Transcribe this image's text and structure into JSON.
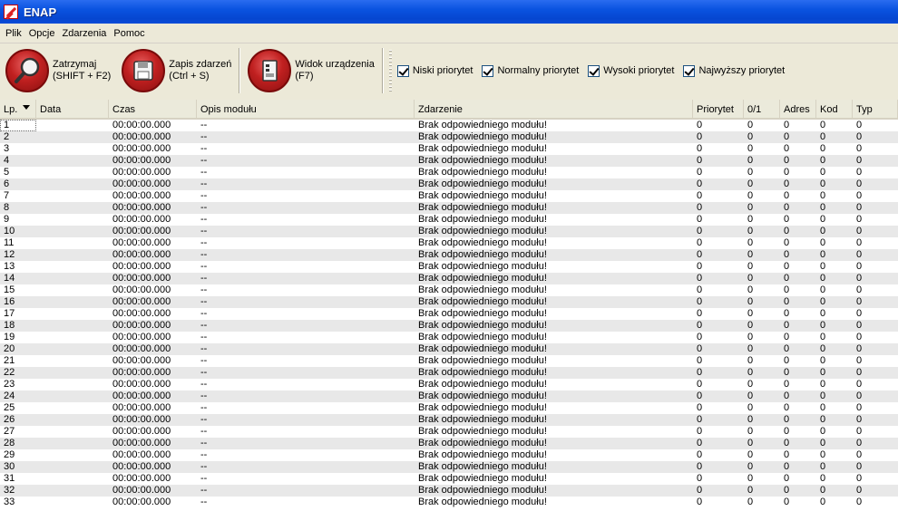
{
  "window": {
    "title": "ENAP"
  },
  "menu": [
    "Plik",
    "Opcje",
    "Zdarzenia",
    "Pomoc"
  ],
  "toolbar": {
    "stop": {
      "line1": "Zatrzymaj",
      "line2": "(SHIFT + F2)",
      "icon": "magnifier-icon"
    },
    "save": {
      "line1": "Zapis zdarzeń",
      "line2": "(Ctrl + S)",
      "icon": "floppy-disk-icon"
    },
    "device": {
      "line1": "Widok urządzenia",
      "line2": "(F7)",
      "icon": "device-icon"
    },
    "filters": [
      {
        "label": "Niski priorytet",
        "checked": true
      },
      {
        "label": "Normalny priorytet",
        "checked": true
      },
      {
        "label": "Wysoki priorytet",
        "checked": true
      },
      {
        "label": "Najwyższy priorytet",
        "checked": true
      }
    ]
  },
  "table": {
    "columns": [
      "Lp.",
      "Data",
      "Czas",
      "Opis modułu",
      "Zdarzenie",
      "Priorytet",
      "0/1",
      "Adres",
      "Kod",
      "Typ"
    ],
    "sort_column": "Lp.",
    "row_template": {
      "data": "",
      "czas": "00:00:00.000",
      "opis": "--",
      "zdarzenie": "Brak odpowiedniego modułu!",
      "priorytet": "0",
      "v01": "0",
      "adres": "0",
      "kod": "0",
      "typ": "0"
    },
    "rows": [
      [
        "1",
        "",
        "00:00:00.000",
        "--",
        "Brak odpowiedniego modułu!",
        "0",
        "0",
        "0",
        "0",
        "0"
      ],
      [
        "2",
        "",
        "00:00:00.000",
        "--",
        "Brak odpowiedniego modułu!",
        "0",
        "0",
        "0",
        "0",
        "0"
      ],
      [
        "3",
        "",
        "00:00:00.000",
        "--",
        "Brak odpowiedniego modułu!",
        "0",
        "0",
        "0",
        "0",
        "0"
      ],
      [
        "4",
        "",
        "00:00:00.000",
        "--",
        "Brak odpowiedniego modułu!",
        "0",
        "0",
        "0",
        "0",
        "0"
      ],
      [
        "5",
        "",
        "00:00:00.000",
        "--",
        "Brak odpowiedniego modułu!",
        "0",
        "0",
        "0",
        "0",
        "0"
      ],
      [
        "6",
        "",
        "00:00:00.000",
        "--",
        "Brak odpowiedniego modułu!",
        "0",
        "0",
        "0",
        "0",
        "0"
      ],
      [
        "7",
        "",
        "00:00:00.000",
        "--",
        "Brak odpowiedniego modułu!",
        "0",
        "0",
        "0",
        "0",
        "0"
      ],
      [
        "8",
        "",
        "00:00:00.000",
        "--",
        "Brak odpowiedniego modułu!",
        "0",
        "0",
        "0",
        "0",
        "0"
      ],
      [
        "9",
        "",
        "00:00:00.000",
        "--",
        "Brak odpowiedniego modułu!",
        "0",
        "0",
        "0",
        "0",
        "0"
      ],
      [
        "10",
        "",
        "00:00:00.000",
        "--",
        "Brak odpowiedniego modułu!",
        "0",
        "0",
        "0",
        "0",
        "0"
      ],
      [
        "11",
        "",
        "00:00:00.000",
        "--",
        "Brak odpowiedniego modułu!",
        "0",
        "0",
        "0",
        "0",
        "0"
      ],
      [
        "12",
        "",
        "00:00:00.000",
        "--",
        "Brak odpowiedniego modułu!",
        "0",
        "0",
        "0",
        "0",
        "0"
      ],
      [
        "13",
        "",
        "00:00:00.000",
        "--",
        "Brak odpowiedniego modułu!",
        "0",
        "0",
        "0",
        "0",
        "0"
      ],
      [
        "14",
        "",
        "00:00:00.000",
        "--",
        "Brak odpowiedniego modułu!",
        "0",
        "0",
        "0",
        "0",
        "0"
      ],
      [
        "15",
        "",
        "00:00:00.000",
        "--",
        "Brak odpowiedniego modułu!",
        "0",
        "0",
        "0",
        "0",
        "0"
      ],
      [
        "16",
        "",
        "00:00:00.000",
        "--",
        "Brak odpowiedniego modułu!",
        "0",
        "0",
        "0",
        "0",
        "0"
      ],
      [
        "17",
        "",
        "00:00:00.000",
        "--",
        "Brak odpowiedniego modułu!",
        "0",
        "0",
        "0",
        "0",
        "0"
      ],
      [
        "18",
        "",
        "00:00:00.000",
        "--",
        "Brak odpowiedniego modułu!",
        "0",
        "0",
        "0",
        "0",
        "0"
      ],
      [
        "19",
        "",
        "00:00:00.000",
        "--",
        "Brak odpowiedniego modułu!",
        "0",
        "0",
        "0",
        "0",
        "0"
      ],
      [
        "20",
        "",
        "00:00:00.000",
        "--",
        "Brak odpowiedniego modułu!",
        "0",
        "0",
        "0",
        "0",
        "0"
      ],
      [
        "21",
        "",
        "00:00:00.000",
        "--",
        "Brak odpowiedniego modułu!",
        "0",
        "0",
        "0",
        "0",
        "0"
      ],
      [
        "22",
        "",
        "00:00:00.000",
        "--",
        "Brak odpowiedniego modułu!",
        "0",
        "0",
        "0",
        "0",
        "0"
      ],
      [
        "23",
        "",
        "00:00:00.000",
        "--",
        "Brak odpowiedniego modułu!",
        "0",
        "0",
        "0",
        "0",
        "0"
      ],
      [
        "24",
        "",
        "00:00:00.000",
        "--",
        "Brak odpowiedniego modułu!",
        "0",
        "0",
        "0",
        "0",
        "0"
      ],
      [
        "25",
        "",
        "00:00:00.000",
        "--",
        "Brak odpowiedniego modułu!",
        "0",
        "0",
        "0",
        "0",
        "0"
      ],
      [
        "26",
        "",
        "00:00:00.000",
        "--",
        "Brak odpowiedniego modułu!",
        "0",
        "0",
        "0",
        "0",
        "0"
      ],
      [
        "27",
        "",
        "00:00:00.000",
        "--",
        "Brak odpowiedniego modułu!",
        "0",
        "0",
        "0",
        "0",
        "0"
      ],
      [
        "28",
        "",
        "00:00:00.000",
        "--",
        "Brak odpowiedniego modułu!",
        "0",
        "0",
        "0",
        "0",
        "0"
      ],
      [
        "29",
        "",
        "00:00:00.000",
        "--",
        "Brak odpowiedniego modułu!",
        "0",
        "0",
        "0",
        "0",
        "0"
      ],
      [
        "30",
        "",
        "00:00:00.000",
        "--",
        "Brak odpowiedniego modułu!",
        "0",
        "0",
        "0",
        "0",
        "0"
      ],
      [
        "31",
        "",
        "00:00:00.000",
        "--",
        "Brak odpowiedniego modułu!",
        "0",
        "0",
        "0",
        "0",
        "0"
      ],
      [
        "32",
        "",
        "00:00:00.000",
        "--",
        "Brak odpowiedniego modułu!",
        "0",
        "0",
        "0",
        "0",
        "0"
      ],
      [
        "33",
        "",
        "00:00:00.000",
        "--",
        "Brak odpowiedniego modułu!",
        "0",
        "0",
        "0",
        "0",
        "0"
      ]
    ]
  },
  "colors": {
    "title_bar": "#0a53e0",
    "toolbar_icon": "#c02020",
    "row_alt": "#e8e8e8"
  }
}
